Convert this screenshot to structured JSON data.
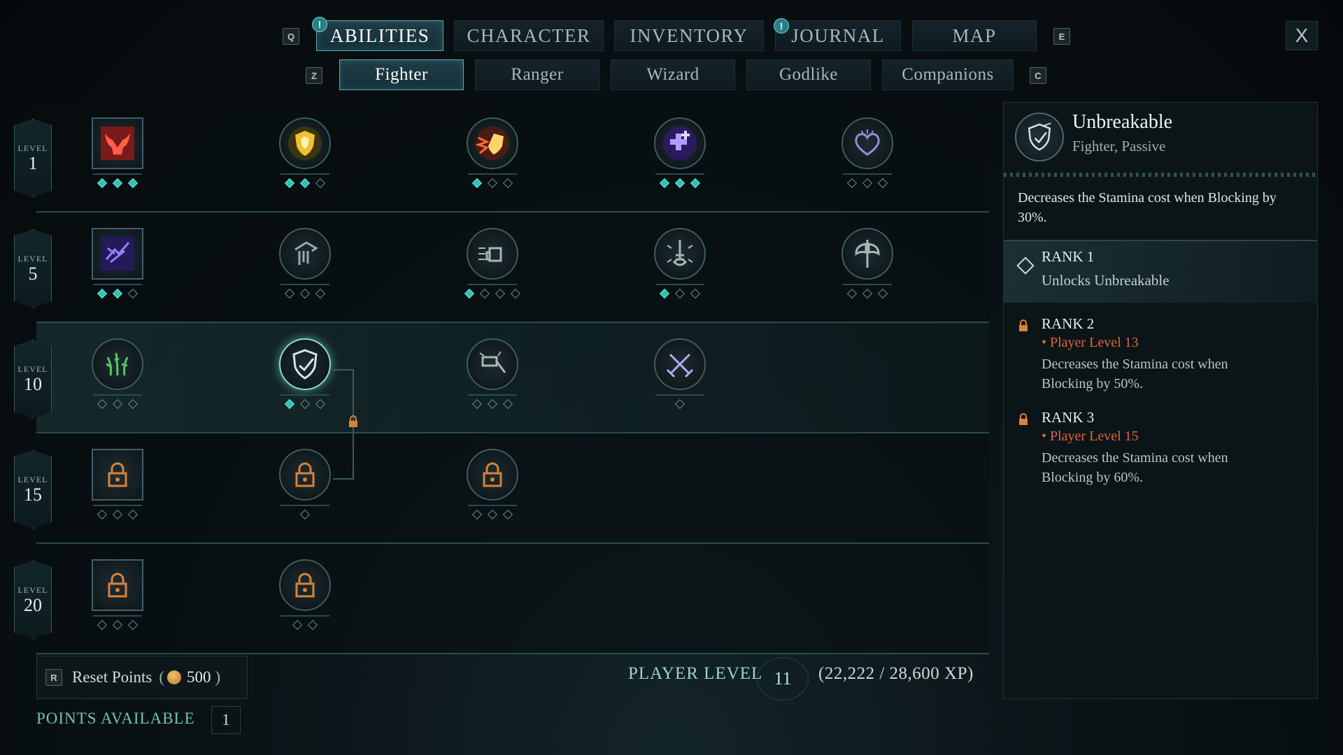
{
  "top_tabs": {
    "left_key": "Q",
    "right_key": "E",
    "items": [
      {
        "label": "ABILITIES",
        "notify": "!"
      },
      {
        "label": "CHARACTER"
      },
      {
        "label": "INVENTORY"
      },
      {
        "label": "JOURNAL",
        "notify": "!"
      },
      {
        "label": "MAP"
      }
    ],
    "active": "ABILITIES",
    "close_label": "X"
  },
  "sub_tabs": {
    "left_key": "Z",
    "right_key": "C",
    "items": [
      "Fighter",
      "Ranger",
      "Wizard",
      "Godlike",
      "Companions"
    ],
    "active": "Fighter"
  },
  "tree": {
    "level_word": "LEVEL",
    "rows": [
      {
        "level": "1",
        "nodes": [
          {
            "icon": "bull-rage-icon",
            "shape": "square",
            "ranks": [
              1,
              1,
              1
            ]
          },
          {
            "icon": "golden-shield-icon",
            "shape": "circle",
            "ranks": [
              1,
              1,
              0
            ]
          },
          {
            "icon": "shield-bash-icon",
            "shape": "circle",
            "ranks": [
              1,
              0,
              0
            ]
          },
          {
            "icon": "healing-cross-icon",
            "shape": "circle",
            "ranks": [
              1,
              1,
              1
            ]
          },
          {
            "icon": "heart-icon",
            "shape": "circle",
            "ranks": [
              0,
              0,
              0
            ]
          }
        ]
      },
      {
        "level": "5",
        "nodes": [
          {
            "icon": "shattering-strike-icon",
            "shape": "square",
            "ranks": [
              1,
              1,
              0
            ]
          },
          {
            "icon": "cleave-icon",
            "shape": "circle",
            "ranks": [
              0,
              0,
              0
            ]
          },
          {
            "icon": "power-fist-icon",
            "shape": "circle",
            "ranks": [
              1,
              0,
              0,
              0
            ]
          },
          {
            "icon": "sword-burst-icon",
            "shape": "circle",
            "ranks": [
              1,
              0,
              0
            ]
          },
          {
            "icon": "double-axe-icon",
            "shape": "circle",
            "ranks": [
              0,
              0,
              0
            ]
          }
        ]
      },
      {
        "level": "10",
        "nodes": [
          {
            "icon": "thorns-icon",
            "shape": "circle",
            "ranks": [
              0,
              0,
              0
            ]
          },
          {
            "icon": "unbreakable-shield-icon",
            "shape": "circle",
            "ranks": [
              1,
              0,
              0
            ],
            "selected": true
          },
          {
            "icon": "hammer-icon",
            "shape": "circle",
            "ranks": [
              0,
              0,
              0
            ]
          },
          {
            "icon": "crossed-swords-icon",
            "shape": "circle",
            "ranks": [
              0
            ]
          }
        ]
      },
      {
        "level": "15",
        "nodes": [
          {
            "icon": "locked-icon",
            "shape": "square",
            "ranks": [
              0,
              0,
              0
            ],
            "locked": true
          },
          {
            "icon": "locked-icon",
            "shape": "circle",
            "ranks": [
              0
            ],
            "locked": true
          },
          {
            "icon": "locked-icon",
            "shape": "circle",
            "ranks": [
              0,
              0,
              0
            ],
            "locked": true
          }
        ]
      },
      {
        "level": "20",
        "nodes": [
          {
            "icon": "locked-icon",
            "shape": "square",
            "ranks": [
              0,
              0,
              0
            ],
            "locked": true
          },
          {
            "icon": "locked-icon",
            "shape": "circle",
            "ranks": [
              0,
              0
            ],
            "locked": true
          }
        ]
      }
    ]
  },
  "bottom": {
    "reset_key": "R",
    "reset_label": "Reset Points",
    "reset_cost": "500",
    "player_level_label": "PLAYER LEVEL",
    "player_level": "11",
    "xp": "(22,222 / 28,600 XP)",
    "points_available_label": "POINTS AVAILABLE",
    "points_available": "1"
  },
  "detail": {
    "name": "Unbreakable",
    "subtitle": "Fighter, Passive",
    "description": "Decreases the Stamina cost when Blocking by 30%.",
    "ranks": [
      {
        "title": "RANK 1",
        "requirement": "",
        "text": "Unlocks Unbreakable",
        "unlocked": true
      },
      {
        "title": "RANK 2",
        "requirement": "• Player Level 13",
        "text": "Decreases the Stamina cost when Blocking by 50%.",
        "unlocked": false
      },
      {
        "title": "RANK 3",
        "requirement": "• Player Level 15",
        "text": "Decreases the Stamina cost when Blocking by 60%.",
        "unlocked": false
      }
    ]
  },
  "colors": {
    "accent": "#2ec3b3",
    "requirement": "#e0643c",
    "lock": "#d8823a"
  }
}
